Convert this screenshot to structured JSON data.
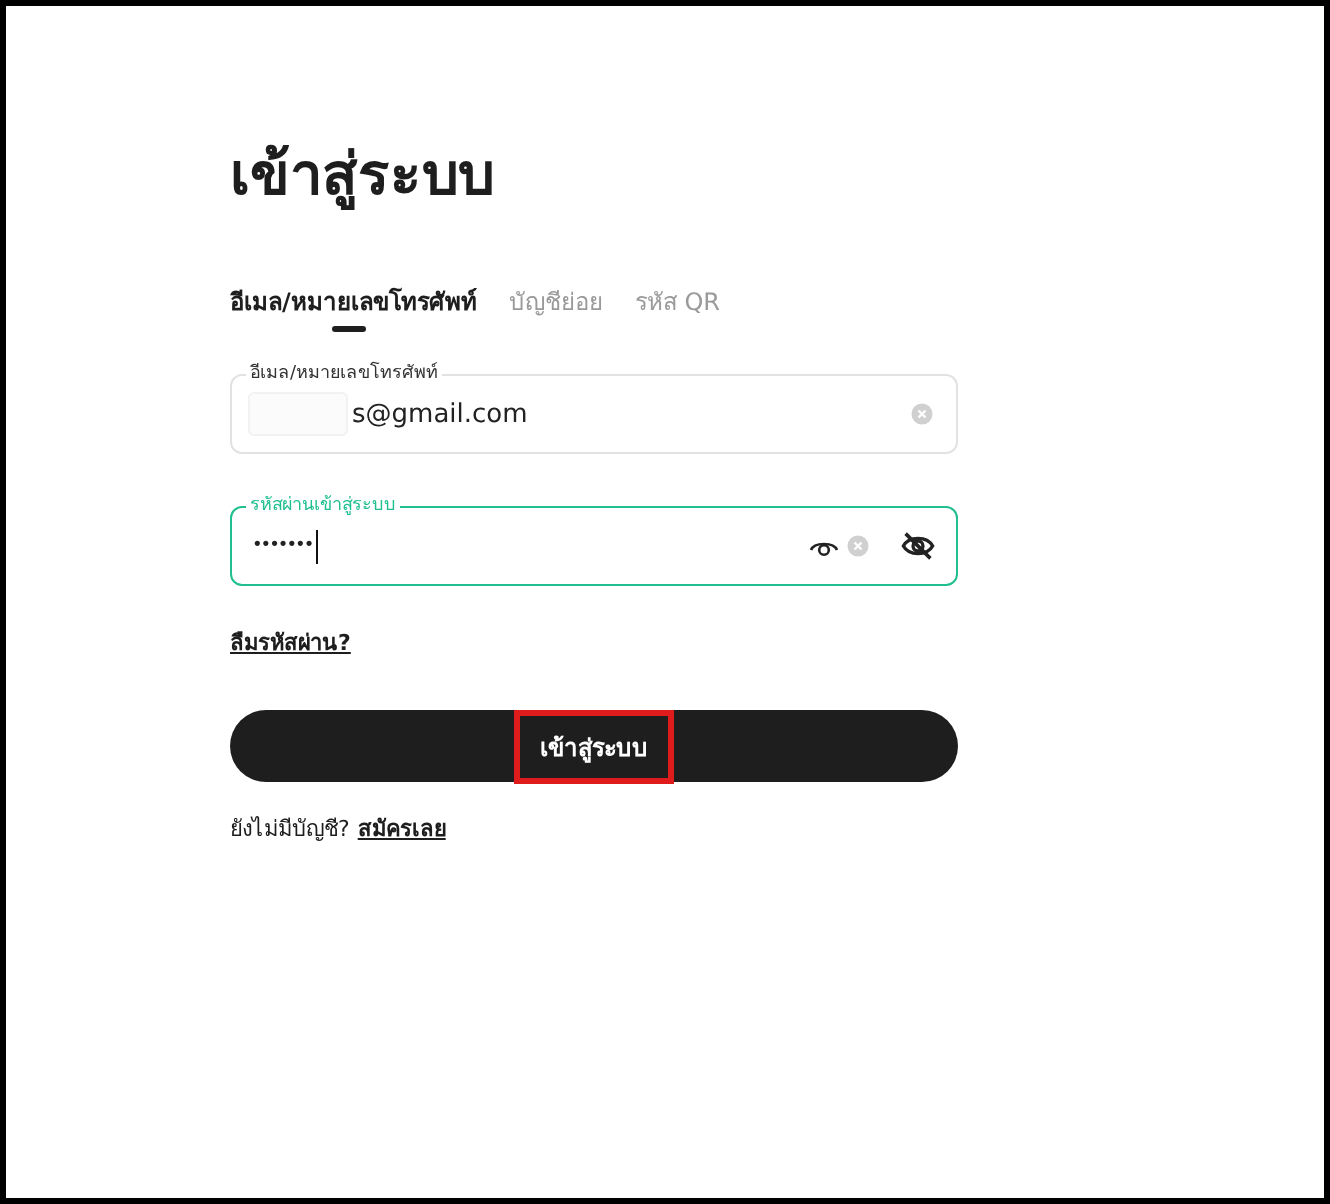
{
  "title": "เข้าสู่ระบบ",
  "tabs": [
    {
      "label": "อีเมล/หมายเลขโทรศัพท์",
      "selected": true
    },
    {
      "label": "บัญชีย่อย",
      "selected": false
    },
    {
      "label": "รหัส QR",
      "selected": false
    }
  ],
  "fields": [
    {
      "kind": "email",
      "label": "อีเมล/หมายเลขโทรศัพท์",
      "value": "s@gmail.com",
      "focused": false,
      "redacted": true
    },
    {
      "kind": "password",
      "label": "รหัสผ่านเข้าสู่ระบบ",
      "value": "•••••••",
      "focused": true,
      "redacted": false
    }
  ],
  "forgot_link": "ลืมรหัสผ่าน?",
  "submit_button": {
    "label": "เข้าสู่ระบบ",
    "highlighted": true
  },
  "signup": {
    "prompt": "ยังไม่มีบัญชี?",
    "link": "สมัครเลย"
  }
}
